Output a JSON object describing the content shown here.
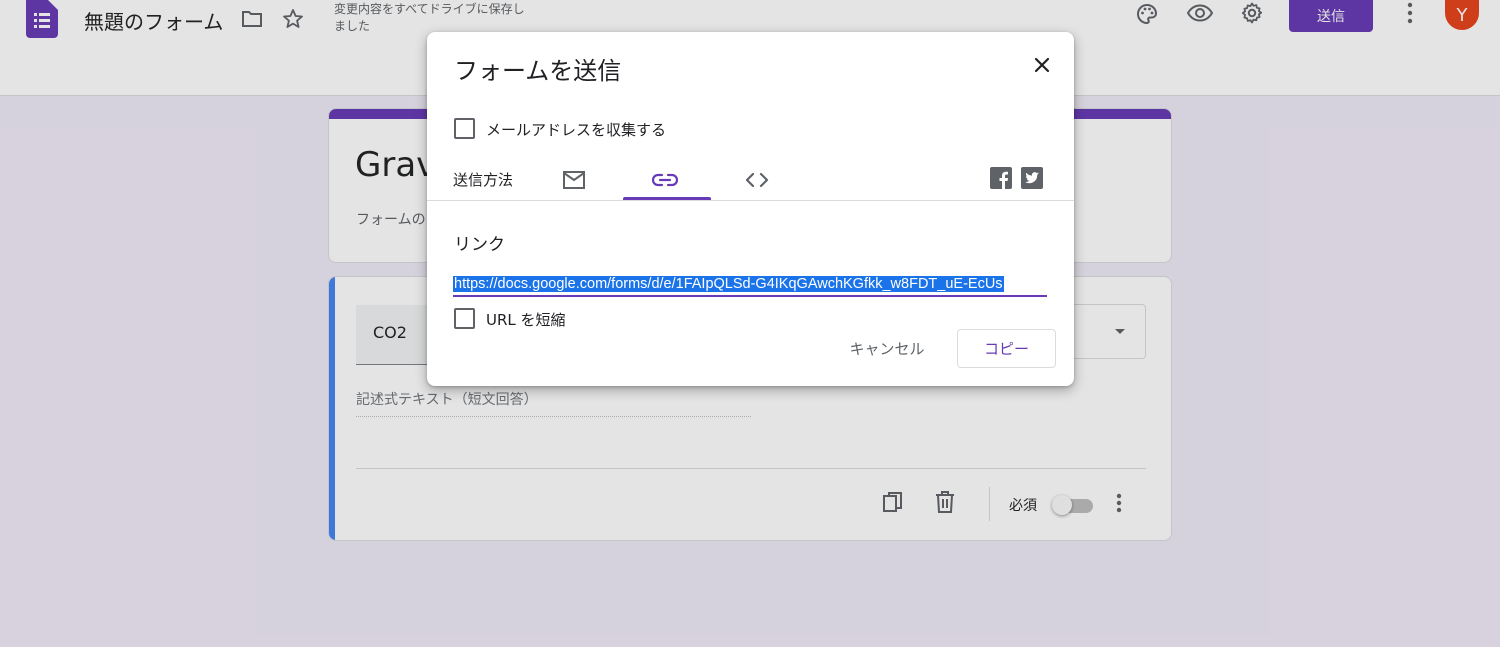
{
  "header": {
    "form_title": "無題のフォーム",
    "save_status": "変更内容をすべてドライブに保存しました",
    "send_label": "送信",
    "avatar_initial": "Y",
    "icons": [
      "forms-logo-icon",
      "folder-icon",
      "star-icon",
      "palette-icon",
      "eye-icon",
      "gear-icon",
      "more-vert-icon"
    ]
  },
  "form": {
    "title_partial": "Grav",
    "description_partial": "フォームの",
    "question": {
      "title": "CO2",
      "answer_placeholder": "記述式テキスト（短文回答）",
      "required_label": "必須",
      "required_on": false
    }
  },
  "dialog": {
    "title": "フォームを送信",
    "collect_email_label": "メールアドレスを収集する",
    "collect_email_checked": false,
    "send_via_label": "送信方法",
    "tabs": [
      "email",
      "link",
      "embed"
    ],
    "active_tab": "link",
    "link_heading": "リンク",
    "link_url": "https://docs.google.com/forms/d/e/1FAIpQLSd-G4IKqGAwchKGfkk_w8FDT_uE-EcUs",
    "shorten_url_label": "URL を短縮",
    "shorten_url_checked": false,
    "cancel_label": "キャンセル",
    "copy_label": "コピー"
  },
  "colors": {
    "accent": "#673ab7",
    "background": "#f0ebf8",
    "selection": "#1a73e8",
    "question_bar": "#4285f4",
    "avatar": "#e8431b"
  }
}
